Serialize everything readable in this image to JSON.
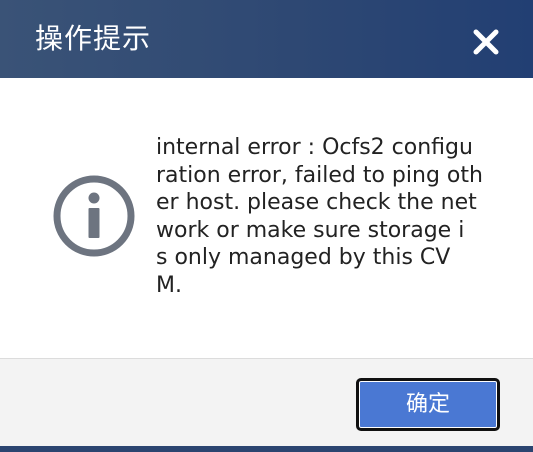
{
  "dialog": {
    "title": "操作提示",
    "close_icon": "close-icon",
    "message": "internal error : Ocfs2 configu\nration error, failed to ping oth\ner host. please check the net\nwork or make sure storage i\ns only managed by this CV\nM.",
    "info_icon": "info-circle-icon",
    "ok_label": "确定"
  },
  "colors": {
    "title_bar": "#2e4873",
    "ok_button": "#4a78d3",
    "icon": "#6d7480"
  }
}
